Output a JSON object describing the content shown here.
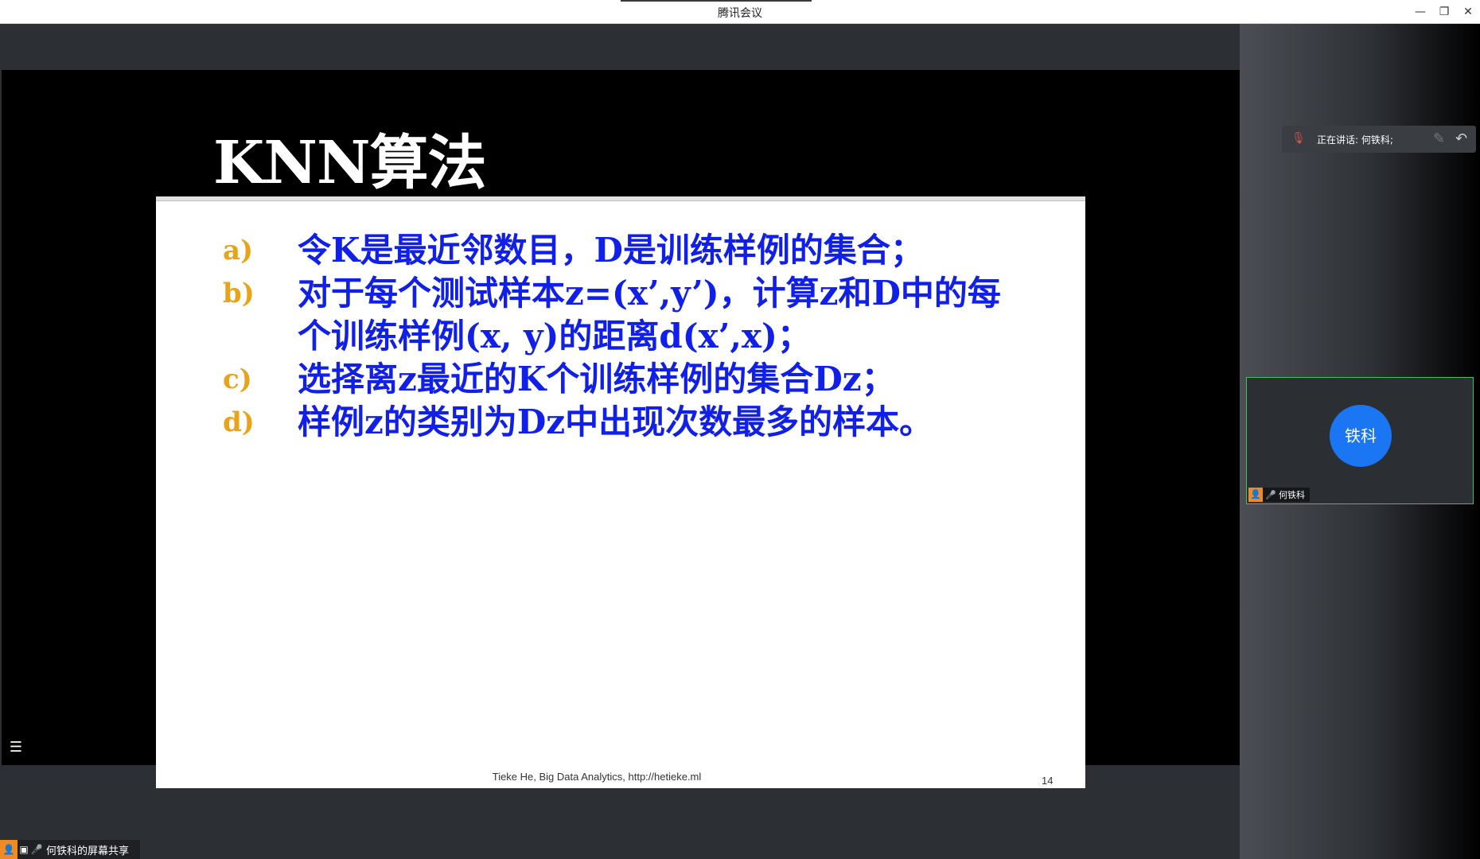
{
  "window": {
    "title": "腾讯会议",
    "controls": {
      "minimize": "—",
      "restore": "❐",
      "close": "✕"
    }
  },
  "slide": {
    "title": "KNN算法",
    "bullets": [
      {
        "marker": "a)",
        "lines": [
          "令K是最近邻数目，D是训练样例的集合；"
        ]
      },
      {
        "marker": "b)",
        "lines": [
          "对于每个测试样本z=(x’,y’)，计算z和D中的每",
          "个训练样例(x, y)的距离d(x’,x)；"
        ]
      },
      {
        "marker": "c)",
        "lines": [
          "选择离z最近的K个训练样例的集合Dz；"
        ]
      },
      {
        "marker": "d)",
        "lines": [
          "样例z的类别为Dz中出现次数最多的样本。"
        ]
      }
    ],
    "footer": "Tieke He,  Big Data Analytics, http://hetieke.ml",
    "page_number": "14",
    "colors": {
      "marker": "#e9a318",
      "text": "#1020ea"
    }
  },
  "share_bar": {
    "label": "何铁科的屏幕共享",
    "icons": [
      "user-icon",
      "screen-share-icon",
      "mic-icon"
    ]
  },
  "speaking": {
    "label": "正在讲话: 何铁科;",
    "icons": [
      "mic-muted-icon",
      "pen-icon",
      "reply-icon"
    ]
  },
  "participant": {
    "avatar_text": "铁科",
    "name": "何铁科",
    "avatar_color": "#1a76f2",
    "border_color": "#3cc35a"
  }
}
